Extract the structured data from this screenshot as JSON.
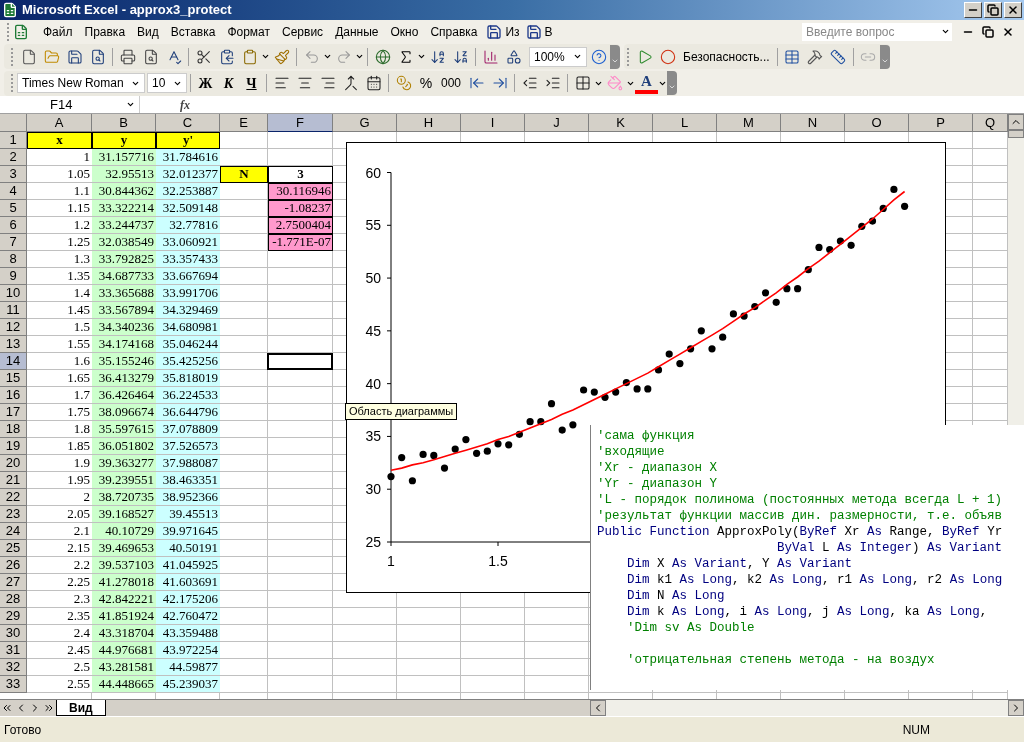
{
  "window": {
    "title": "Microsoft Excel - approx3_protect"
  },
  "menu": [
    "Файл",
    "Правка",
    "Вид",
    "Вставка",
    "Формат",
    "Сервис",
    "Данные",
    "Окно",
    "Справка"
  ],
  "menu_macros": [
    "Из",
    "В"
  ],
  "help_search": {
    "placeholder": "Введите вопрос"
  },
  "standard_toolbar": {
    "zoom": "100%"
  },
  "macro_toolbar": {
    "security": "Безопасность..."
  },
  "format_toolbar": {
    "font": "Times New Roman",
    "size": "10",
    "bold": "Ж",
    "italic": "К",
    "underline": "Ч",
    "percent": "%",
    "thousands": "000",
    "font_color": "A"
  },
  "formula_bar": {
    "name_box": "F14",
    "fx": "fx"
  },
  "columns": [
    {
      "label": "A",
      "selected": false
    },
    {
      "label": "B",
      "selected": false,
      "color": "#ccffcc"
    },
    {
      "label": "C",
      "selected": false,
      "color": "#ccffff"
    },
    {
      "label": "E",
      "selected": false
    },
    {
      "label": "F",
      "selected": true
    },
    {
      "label": "G",
      "selected": false
    },
    {
      "label": "H",
      "selected": false
    },
    {
      "label": "I",
      "selected": false
    },
    {
      "label": "J",
      "selected": false
    },
    {
      "label": "K",
      "selected": false
    },
    {
      "label": "L",
      "selected": false
    },
    {
      "label": "M",
      "selected": false
    },
    {
      "label": "N",
      "selected": false
    },
    {
      "label": "O",
      "selected": false
    },
    {
      "label": "P",
      "selected": false
    },
    {
      "label": "Q",
      "selected": false
    }
  ],
  "rows": [
    {
      "number": "1",
      "selected": false,
      "cells": {
        "a": {
          "text": "x",
          "kind": "label",
          "color": "#ffff00"
        },
        "b": {
          "text": "y",
          "kind": "label",
          "color": "#ffff00"
        },
        "c": {
          "text": "y'",
          "kind": "label",
          "color": "#ffff00"
        }
      }
    },
    {
      "number": "2",
      "selected": false,
      "cells": {
        "a": {
          "text": "1",
          "kind": "value"
        },
        "b": {
          "text": "31.157716",
          "kind": "value"
        },
        "c": {
          "text": "31.784616",
          "kind": "value"
        }
      }
    },
    {
      "number": "3",
      "selected": false,
      "cells": {
        "a": {
          "text": "1.05",
          "kind": "value"
        },
        "b": {
          "text": "32.95513",
          "kind": "value"
        },
        "c": {
          "text": "32.012377",
          "kind": "value"
        },
        "e": {
          "text": "N",
          "kind": "label",
          "color": "#ffff00"
        },
        "f": {
          "text": "3",
          "kind": "label"
        }
      }
    },
    {
      "number": "4",
      "selected": false,
      "cells": {
        "a": {
          "text": "1.1",
          "kind": "value"
        },
        "b": {
          "text": "30.844362",
          "kind": "value"
        },
        "c": {
          "text": "32.253887",
          "kind": "value"
        },
        "f": {
          "text": "30.116946",
          "kind": "param",
          "color": "#ff99cc"
        }
      }
    },
    {
      "number": "5",
      "selected": false,
      "cells": {
        "a": {
          "text": "1.15",
          "kind": "value"
        },
        "b": {
          "text": "33.322214",
          "kind": "value"
        },
        "c": {
          "text": "32.509148",
          "kind": "value"
        },
        "f": {
          "text": "-1.08237",
          "kind": "param",
          "color": "#ff99cc"
        }
      }
    },
    {
      "number": "6",
      "selected": false,
      "cells": {
        "a": {
          "text": "1.2",
          "kind": "value"
        },
        "b": {
          "text": "33.244737",
          "kind": "value"
        },
        "c": {
          "text": "32.77816",
          "kind": "value"
        },
        "f": {
          "text": "2.7500404",
          "kind": "param",
          "color": "#ff99cc"
        }
      }
    },
    {
      "number": "7",
      "selected": false,
      "cells": {
        "a": {
          "text": "1.25",
          "kind": "value"
        },
        "b": {
          "text": "32.038549",
          "kind": "value"
        },
        "c": {
          "text": "33.060921",
          "kind": "value"
        },
        "f": {
          "text": "-1.771E-07",
          "kind": "param",
          "color": "#ff99cc"
        }
      }
    },
    {
      "number": "8",
      "selected": false,
      "cells": {
        "a": {
          "text": "1.3",
          "kind": "value"
        },
        "b": {
          "text": "33.792825",
          "kind": "value"
        },
        "c": {
          "text": "33.357433",
          "kind": "value"
        }
      }
    },
    {
      "number": "9",
      "selected": false,
      "cells": {
        "a": {
          "text": "1.35",
          "kind": "value"
        },
        "b": {
          "text": "34.687733",
          "kind": "value"
        },
        "c": {
          "text": "33.667694",
          "kind": "value"
        }
      }
    },
    {
      "number": "10",
      "selected": false,
      "cells": {
        "a": {
          "text": "1.4",
          "kind": "value"
        },
        "b": {
          "text": "33.365688",
          "kind": "value"
        },
        "c": {
          "text": "33.991706",
          "kind": "value"
        }
      }
    },
    {
      "number": "11",
      "selected": false,
      "cells": {
        "a": {
          "text": "1.45",
          "kind": "value"
        },
        "b": {
          "text": "33.567894",
          "kind": "value"
        },
        "c": {
          "text": "34.329469",
          "kind": "value"
        }
      }
    },
    {
      "number": "12",
      "selected": false,
      "cells": {
        "a": {
          "text": "1.5",
          "kind": "value"
        },
        "b": {
          "text": "34.340236",
          "kind": "value"
        },
        "c": {
          "text": "34.680981",
          "kind": "value"
        }
      }
    },
    {
      "number": "13",
      "selected": false,
      "cells": {
        "a": {
          "text": "1.55",
          "kind": "value"
        },
        "b": {
          "text": "34.174168",
          "kind": "value"
        },
        "c": {
          "text": "35.046244",
          "kind": "value"
        }
      }
    },
    {
      "number": "14",
      "selected": true,
      "cells": {
        "a": {
          "text": "1.6",
          "kind": "value"
        },
        "b": {
          "text": "35.155246",
          "kind": "value"
        },
        "c": {
          "text": "35.425256",
          "kind": "value"
        },
        "f": {
          "kind": "cursor"
        }
      }
    },
    {
      "number": "15",
      "selected": false,
      "cells": {
        "a": {
          "text": "1.65",
          "kind": "value"
        },
        "b": {
          "text": "36.413279",
          "kind": "value"
        },
        "c": {
          "text": "35.818019",
          "kind": "value"
        }
      }
    },
    {
      "number": "16",
      "selected": false,
      "cells": {
        "a": {
          "text": "1.7",
          "kind": "value"
        },
        "b": {
          "text": "36.426464",
          "kind": "value"
        },
        "c": {
          "text": "36.224533",
          "kind": "value"
        }
      }
    },
    {
      "number": "17",
      "selected": false,
      "cells": {
        "a": {
          "text": "1.75",
          "kind": "value"
        },
        "b": {
          "text": "38.096674",
          "kind": "value"
        },
        "c": {
          "text": "36.644796",
          "kind": "value"
        }
      }
    },
    {
      "number": "18",
      "selected": false,
      "cells": {
        "a": {
          "text": "1.8",
          "kind": "value"
        },
        "b": {
          "text": "35.597615",
          "kind": "value"
        },
        "c": {
          "text": "37.078809",
          "kind": "value"
        }
      }
    },
    {
      "number": "19",
      "selected": false,
      "cells": {
        "a": {
          "text": "1.85",
          "kind": "value"
        },
        "b": {
          "text": "36.051802",
          "kind": "value"
        },
        "c": {
          "text": "37.526573",
          "kind": "value"
        }
      }
    },
    {
      "number": "20",
      "selected": false,
      "cells": {
        "a": {
          "text": "1.9",
          "kind": "value"
        },
        "b": {
          "text": "39.363277",
          "kind": "value"
        },
        "c": {
          "text": "37.988087",
          "kind": "value"
        }
      }
    },
    {
      "number": "21",
      "selected": false,
      "cells": {
        "a": {
          "text": "1.95",
          "kind": "value"
        },
        "b": {
          "text": "39.239551",
          "kind": "value"
        },
        "c": {
          "text": "38.463351",
          "kind": "value"
        }
      }
    },
    {
      "number": "22",
      "selected": false,
      "cells": {
        "a": {
          "text": "2",
          "kind": "value"
        },
        "b": {
          "text": "38.720735",
          "kind": "value"
        },
        "c": {
          "text": "38.952366",
          "kind": "value"
        }
      }
    },
    {
      "number": "23",
      "selected": false,
      "cells": {
        "a": {
          "text": "2.05",
          "kind": "value"
        },
        "b": {
          "text": "39.168527",
          "kind": "value"
        },
        "c": {
          "text": "39.45513",
          "kind": "value"
        }
      }
    },
    {
      "number": "24",
      "selected": false,
      "cells": {
        "a": {
          "text": "2.1",
          "kind": "value"
        },
        "b": {
          "text": "40.10729",
          "kind": "value"
        },
        "c": {
          "text": "39.971645",
          "kind": "value"
        }
      }
    },
    {
      "number": "25",
      "selected": false,
      "cells": {
        "a": {
          "text": "2.15",
          "kind": "value"
        },
        "b": {
          "text": "39.469653",
          "kind": "value"
        },
        "c": {
          "text": "40.50191",
          "kind": "value"
        }
      }
    },
    {
      "number": "26",
      "selected": false,
      "cells": {
        "a": {
          "text": "2.2",
          "kind": "value"
        },
        "b": {
          "text": "39.537103",
          "kind": "value"
        },
        "c": {
          "text": "41.045925",
          "kind": "value"
        }
      }
    },
    {
      "number": "27",
      "selected": false,
      "cells": {
        "a": {
          "text": "2.25",
          "kind": "value"
        },
        "b": {
          "text": "41.278018",
          "kind": "value"
        },
        "c": {
          "text": "41.603691",
          "kind": "value"
        }
      }
    },
    {
      "number": "28",
      "selected": false,
      "cells": {
        "a": {
          "text": "2.3",
          "kind": "value"
        },
        "b": {
          "text": "42.842221",
          "kind": "value"
        },
        "c": {
          "text": "42.175206",
          "kind": "value"
        }
      }
    },
    {
      "number": "29",
      "selected": false,
      "cells": {
        "a": {
          "text": "2.35",
          "kind": "value"
        },
        "b": {
          "text": "41.851924",
          "kind": "value"
        },
        "c": {
          "text": "42.760472",
          "kind": "value"
        }
      }
    },
    {
      "number": "30",
      "selected": false,
      "cells": {
        "a": {
          "text": "2.4",
          "kind": "value"
        },
        "b": {
          "text": "43.318704",
          "kind": "value"
        },
        "c": {
          "text": "43.359488",
          "kind": "value"
        }
      }
    },
    {
      "number": "31",
      "selected": false,
      "cells": {
        "a": {
          "text": "2.45",
          "kind": "value"
        },
        "b": {
          "text": "44.976681",
          "kind": "value"
        },
        "c": {
          "text": "43.972254",
          "kind": "value"
        }
      }
    },
    {
      "number": "32",
      "selected": false,
      "cells": {
        "a": {
          "text": "2.5",
          "kind": "value"
        },
        "b": {
          "text": "43.281581",
          "kind": "value"
        },
        "c": {
          "text": "44.59877",
          "kind": "value"
        }
      }
    },
    {
      "number": "33",
      "selected": false,
      "cells": {
        "a": {
          "text": "2.55",
          "kind": "value"
        },
        "b": {
          "text": "44.448665",
          "kind": "value"
        },
        "c": {
          "text": "45.239037",
          "kind": "value"
        }
      }
    }
  ],
  "chart": {
    "tooltip": "Область диаграммы",
    "chart_data": {
      "type": "scatter",
      "xlim": [
        1,
        3.5
      ],
      "ylim": [
        25,
        60
      ],
      "xticks": [
        1,
        1.5
      ],
      "yticks": [
        25,
        30,
        35,
        40,
        45,
        50,
        55,
        60
      ],
      "x": [
        1,
        1.05,
        1.1,
        1.15,
        1.2,
        1.25,
        1.3,
        1.35,
        1.4,
        1.45,
        1.5,
        1.55,
        1.6,
        1.65,
        1.7,
        1.75,
        1.8,
        1.85,
        1.9,
        1.95,
        2,
        2.05,
        2.1,
        2.15,
        2.2,
        2.25,
        2.3,
        2.35,
        2.4,
        2.45,
        2.5,
        2.55,
        2.6,
        2.65,
        2.7,
        2.75,
        2.8,
        2.85,
        2.9,
        2.95,
        3,
        3.05,
        3.1,
        3.15,
        3.2,
        3.25,
        3.3,
        3.35,
        3.4
      ],
      "series": [
        {
          "color": "#000000",
          "values": [
            31.2,
            33.0,
            30.8,
            33.3,
            33.2,
            32.0,
            33.8,
            34.7,
            33.4,
            33.6,
            34.3,
            34.2,
            35.2,
            36.4,
            36.4,
            38.1,
            35.6,
            36.1,
            39.4,
            39.2,
            38.7,
            39.2,
            40.1,
            39.5,
            39.5,
            41.3,
            42.8,
            41.9,
            43.3,
            45.0,
            43.3,
            44.4,
            46.6,
            46.4,
            47.3,
            48.6,
            47.7,
            49.0,
            49.0,
            50.8,
            52.9,
            52.7,
            53.5,
            53.1,
            54.9,
            55.4,
            56.6,
            58.4,
            56.8
          ]
        },
        {
          "type": "line",
          "color": "#ff0000",
          "values": [
            31.8,
            32.0,
            32.3,
            32.5,
            32.8,
            33.1,
            33.4,
            33.7,
            34.0,
            34.3,
            34.7,
            35.0,
            35.4,
            35.8,
            36.2,
            36.6,
            37.1,
            37.5,
            38.0,
            38.5,
            39.0,
            39.5,
            40.0,
            40.5,
            41.0,
            41.6,
            42.2,
            42.8,
            43.4,
            44.0,
            44.6,
            45.2,
            45.9,
            46.6,
            47.2,
            47.9,
            48.6,
            49.4,
            50.1,
            50.9,
            51.6,
            52.4,
            53.2,
            54.0,
            54.8,
            55.6,
            56.5,
            57.4,
            58.2
          ]
        }
      ]
    }
  },
  "code": [
    {
      "kind": "code",
      "segments": [
        {
          "text": "'сама функция",
          "kind": "comment"
        }
      ]
    },
    {
      "kind": "code",
      "segments": [
        {
          "text": "'входящие",
          "kind": "comment"
        }
      ]
    },
    {
      "kind": "code",
      "segments": [
        {
          "text": "'Xr - диапазон X",
          "kind": "comment"
        }
      ]
    },
    {
      "kind": "code",
      "segments": [
        {
          "text": "'Yr - диапазон Y",
          "kind": "comment"
        }
      ]
    },
    {
      "kind": "code",
      "segments": [
        {
          "text": "'L - порядок полинома (постоянных метода всегда L + 1)",
          "kind": "comment"
        }
      ]
    },
    {
      "kind": "code",
      "segments": [
        {
          "text": "'результат функции массив дин. размерности, т.е. объяв",
          "kind": "comment"
        }
      ]
    },
    {
      "kind": "code",
      "segments": [
        {
          "text": "Public Function",
          "kind": "keyword"
        },
        {
          "text": " ApproxPoly(",
          "kind": "plain"
        },
        {
          "text": "ByRef",
          "kind": "keyword"
        },
        {
          "text": " Xr ",
          "kind": "plain"
        },
        {
          "text": "As",
          "kind": "keyword"
        },
        {
          "text": " Range, ",
          "kind": "plain"
        },
        {
          "text": "ByRef",
          "kind": "keyword"
        },
        {
          "text": " Yr",
          "kind": "plain"
        }
      ]
    },
    {
      "kind": "code",
      "segments": [
        {
          "text": "                        ByVal",
          "kind": "keyword"
        },
        {
          "text": " L ",
          "kind": "plain"
        },
        {
          "text": "As Integer",
          "kind": "keyword"
        },
        {
          "text": ") ",
          "kind": "plain"
        },
        {
          "text": "As Variant",
          "kind": "keyword"
        }
      ]
    },
    {
      "kind": "code",
      "segments": [
        {
          "text": "    Dim",
          "kind": "keyword"
        },
        {
          "text": " X ",
          "kind": "plain"
        },
        {
          "text": "As Variant",
          "kind": "keyword"
        },
        {
          "text": ", Y ",
          "kind": "plain"
        },
        {
          "text": "As Variant",
          "kind": "keyword"
        }
      ]
    },
    {
      "kind": "code",
      "segments": [
        {
          "text": "    Dim",
          "kind": "keyword"
        },
        {
          "text": " k1 ",
          "kind": "plain"
        },
        {
          "text": "As Long",
          "kind": "keyword"
        },
        {
          "text": ", k2 ",
          "kind": "plain"
        },
        {
          "text": "As Long",
          "kind": "keyword"
        },
        {
          "text": ", r1 ",
          "kind": "plain"
        },
        {
          "text": "As Long",
          "kind": "keyword"
        },
        {
          "text": ", r2 ",
          "kind": "plain"
        },
        {
          "text": "As Long",
          "kind": "keyword"
        }
      ]
    },
    {
      "kind": "code",
      "segments": [
        {
          "text": "    Dim",
          "kind": "keyword"
        },
        {
          "text": " N ",
          "kind": "plain"
        },
        {
          "text": "As Long",
          "kind": "keyword"
        }
      ]
    },
    {
      "kind": "code",
      "segments": [
        {
          "text": "    Dim",
          "kind": "keyword"
        },
        {
          "text": " k ",
          "kind": "plain"
        },
        {
          "text": "As Long",
          "kind": "keyword"
        },
        {
          "text": ", i ",
          "kind": "plain"
        },
        {
          "text": "As Long",
          "kind": "keyword"
        },
        {
          "text": ", j ",
          "kind": "plain"
        },
        {
          "text": "As Long",
          "kind": "keyword"
        },
        {
          "text": ", ka ",
          "kind": "plain"
        },
        {
          "text": "As Long",
          "kind": "keyword"
        },
        {
          "text": ",",
          "kind": "plain"
        }
      ]
    },
    {
      "kind": "code",
      "segments": [
        {
          "text": "    'Dim sv As Double",
          "kind": "comment"
        }
      ]
    },
    {
      "kind": "blank"
    },
    {
      "kind": "code",
      "segments": [
        {
          "text": "    'отрицательная степень метода - на воздух",
          "kind": "comment"
        }
      ]
    }
  ],
  "sheet_tabs": [
    {
      "label": "Вид",
      "selected": true
    }
  ],
  "status_bar": {
    "status": "Готово",
    "num": "NUM"
  }
}
